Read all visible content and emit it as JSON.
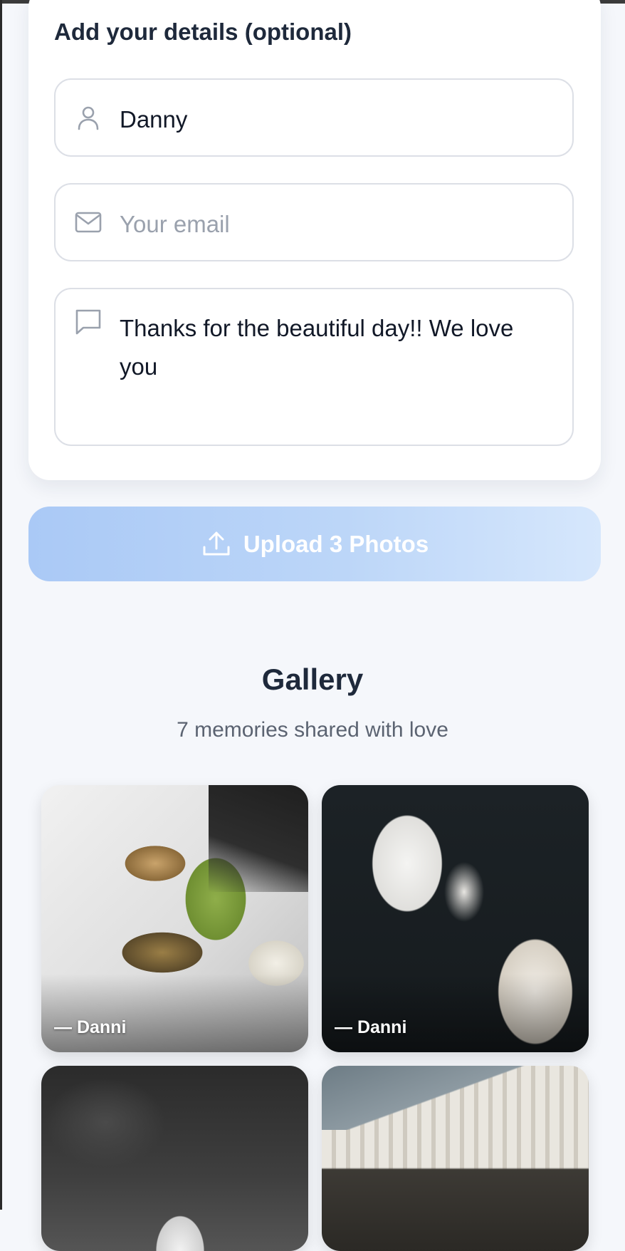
{
  "details": {
    "title": "Add your details (optional)",
    "name_value": "Danny",
    "email_placeholder": "Your email",
    "email_value": "",
    "message_value": "Thanks for the beautiful day!! We love you"
  },
  "upload": {
    "label": "Upload 3 Photos",
    "icon": "upload-icon"
  },
  "gallery": {
    "title": "Gallery",
    "subtitle": "7 memories shared with love",
    "photos": [
      {
        "caption": "— Danni"
      },
      {
        "caption": "— Danni"
      },
      {
        "caption": ""
      },
      {
        "caption": ""
      }
    ]
  },
  "colors": {
    "upload_gradient_start": "#aac9f6",
    "upload_gradient_end": "#d6e7fc",
    "heading": "#1e293b",
    "subtle_text": "#5b6371",
    "field_border": "#dcdfe6",
    "icon_gray": "#9aa1ad"
  }
}
